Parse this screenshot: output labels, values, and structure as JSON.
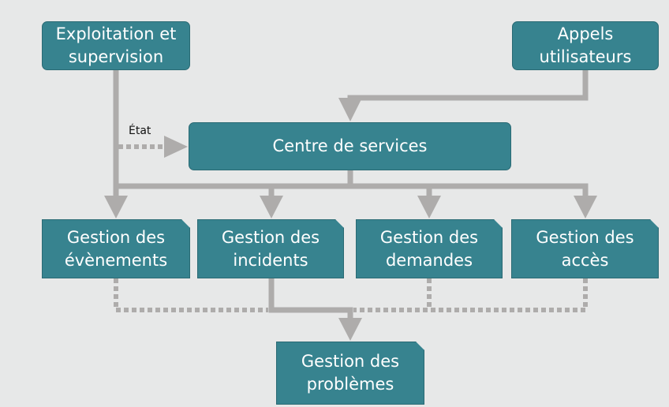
{
  "colors": {
    "box_fill": "#37838f",
    "box_border": "#2a6a74",
    "connector": "#aeacab",
    "background": "#e7e8e8",
    "text": "#ffffff"
  },
  "nodes": {
    "exploitation": "Exploitation et\nsupervision",
    "appels": "Appels\nutilisateurs",
    "centre": "Centre de services",
    "evenements": "Gestion des\névènements",
    "incidents": "Gestion des\nincidents",
    "demandes": "Gestion des\ndemandes",
    "acces": "Gestion des\naccès",
    "problemes": "Gestion des\nproblèmes"
  },
  "labels": {
    "etat": "État"
  },
  "edges": [
    {
      "from": "exploitation",
      "to": "evenements",
      "style": "solid"
    },
    {
      "from": "exploitation",
      "to": "centre",
      "style": "dashed",
      "label": "État"
    },
    {
      "from": "appels",
      "to": "centre",
      "style": "solid"
    },
    {
      "from": "centre",
      "to": "evenements",
      "style": "solid"
    },
    {
      "from": "centre",
      "to": "incidents",
      "style": "solid"
    },
    {
      "from": "centre",
      "to": "demandes",
      "style": "solid"
    },
    {
      "from": "centre",
      "to": "acces",
      "style": "solid"
    },
    {
      "from": "incidents",
      "to": "problemes",
      "style": "solid"
    },
    {
      "from": "evenements",
      "to": "problemes",
      "style": "dashed"
    },
    {
      "from": "demandes",
      "to": "problemes",
      "style": "dashed"
    },
    {
      "from": "acces",
      "to": "problemes",
      "style": "dashed"
    }
  ]
}
